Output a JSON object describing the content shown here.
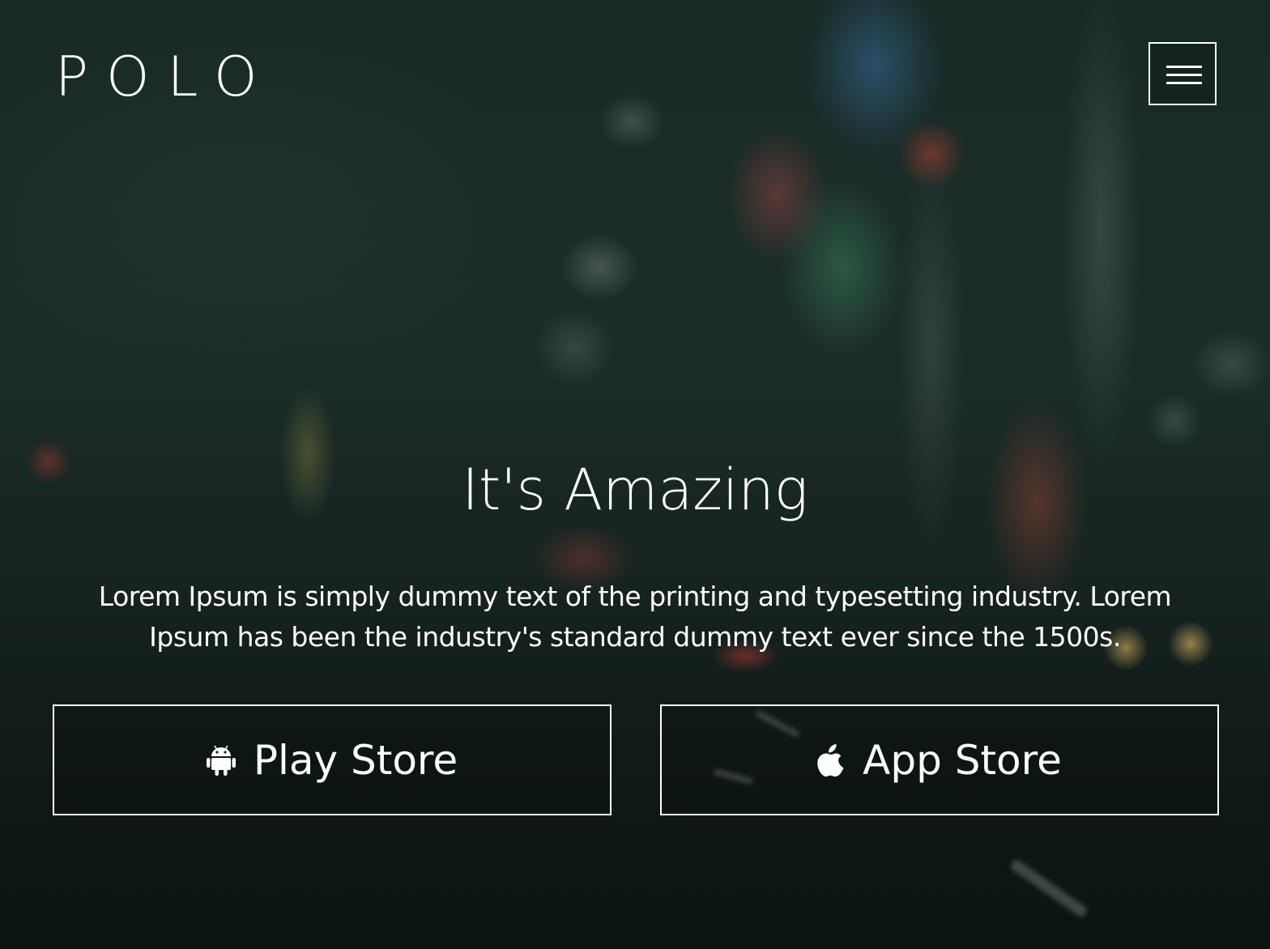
{
  "header": {
    "logo_text": "POLO",
    "menu_icon": "hamburger-menu-icon"
  },
  "hero": {
    "title": "It's Amazing",
    "description": "Lorem Ipsum is simply dummy text of the printing and typesetting industry. Lorem Ipsum has been the industry's standard dummy text ever since the 1500s."
  },
  "buttons": {
    "play_store": {
      "label": "Play Store",
      "icon": "android-icon"
    },
    "app_store": {
      "label": "App Store",
      "icon": "apple-icon"
    }
  },
  "colors": {
    "text": "#ffffff",
    "border": "#ffffff",
    "background_tint": "#1b2a26"
  }
}
